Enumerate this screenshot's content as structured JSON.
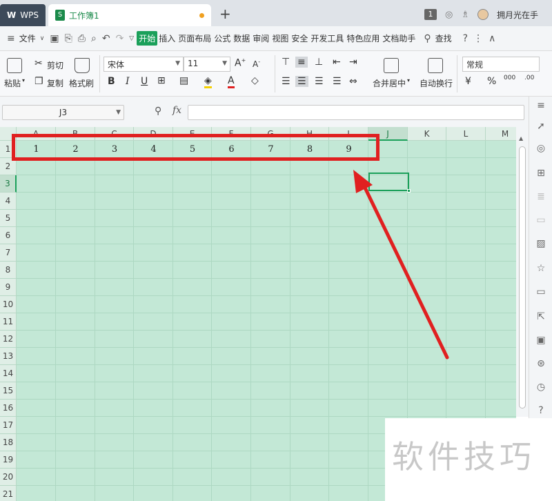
{
  "titlebar": {
    "app_tab": "WPS",
    "doc_tab": "工作簿1",
    "user_name": "拥月光在手",
    "badge": "1"
  },
  "menubar": {
    "file_label": "文件",
    "tabs": [
      "开始",
      "插入",
      "页面布局",
      "公式",
      "数据",
      "审阅",
      "视图",
      "安全",
      "开发工具",
      "特色应用",
      "文档助手"
    ],
    "search_label": "查找"
  },
  "ribbon": {
    "paste": "粘贴",
    "cut": "剪切",
    "copy": "复制",
    "format_painter": "格式刷",
    "font_name": "宋体",
    "font_size": "11",
    "merge_center": "合并居中",
    "wrap_text": "自动换行",
    "number_format": "常规",
    "percent": "%",
    "thousands": "000",
    "decimal": ".00"
  },
  "formula_bar": {
    "name_box": "J3",
    "fx": "fx",
    "value": ""
  },
  "columns": [
    "A",
    "B",
    "C",
    "D",
    "E",
    "F",
    "G",
    "H",
    "I",
    "J",
    "K",
    "L",
    "M"
  ],
  "rows": [
    "1",
    "2",
    "3",
    "4",
    "5",
    "6",
    "7",
    "8",
    "9",
    "10",
    "11",
    "12",
    "13",
    "14",
    "15",
    "16",
    "17",
    "18",
    "19",
    "20",
    "21"
  ],
  "row1_values": [
    "1",
    "2",
    "3",
    "4",
    "5",
    "6",
    "7",
    "8",
    "9"
  ],
  "watermark": "软件技巧",
  "colors": {
    "accent": "#1ba05a",
    "grid_bg": "#c3e8d6",
    "annotation": "#e02020"
  }
}
